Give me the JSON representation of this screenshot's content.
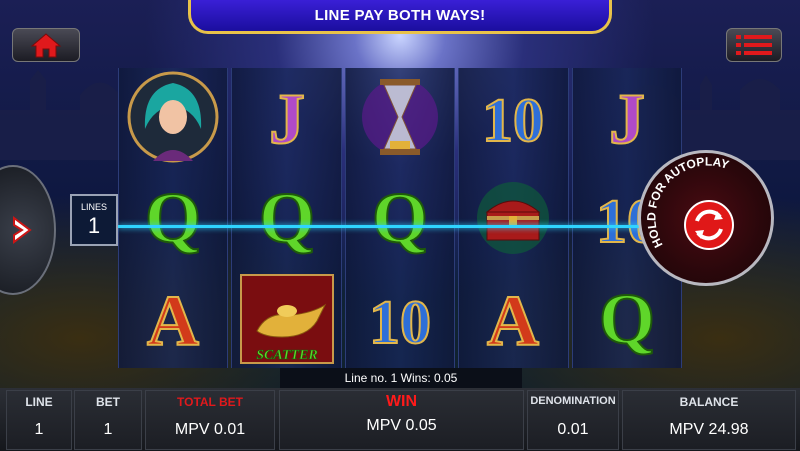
{
  "banner": {
    "text": "LINE PAY BOTH WAYS!"
  },
  "lines_selector": {
    "label": "LINES",
    "value": "1"
  },
  "autoplay": {
    "label": "HOLD FOR AUTOPLAY"
  },
  "reels": [
    [
      "woman-portrait",
      "q-symbol",
      "a-symbol"
    ],
    [
      "j-symbol",
      "q-symbol",
      "lamp-scatter"
    ],
    [
      "hourglass",
      "q-symbol",
      "ten-symbol"
    ],
    [
      "ten-symbol",
      "treasure-chest",
      "a-symbol"
    ],
    [
      "j-symbol",
      "ten-symbol",
      "q-symbol"
    ]
  ],
  "symbols": {
    "j": "J",
    "q": "Q",
    "a": "A",
    "ten": "10",
    "scatter": "SCATTER"
  },
  "status": {
    "message": "Line no. 1 Wins: 0.05"
  },
  "bottom_bar": {
    "line": {
      "label": "LINE",
      "value": "1"
    },
    "bet": {
      "label": "BET",
      "value": "1"
    },
    "total_bet": {
      "label": "TOTAL BET",
      "value": "MPV 0.01"
    },
    "win": {
      "label": "WIN",
      "value": "MPV 0.05"
    },
    "denomination": {
      "label": "DENOMINATION",
      "value": "0.01"
    },
    "balance": {
      "label": "BALANCE",
      "value": "MPV 24.98"
    }
  },
  "colors": {
    "banner_bg": "#2a16c2",
    "banner_border": "#e8c24a",
    "payline": "#2fd4ff",
    "win_label": "#ff1a1a",
    "home_icon": "#e0191c"
  }
}
